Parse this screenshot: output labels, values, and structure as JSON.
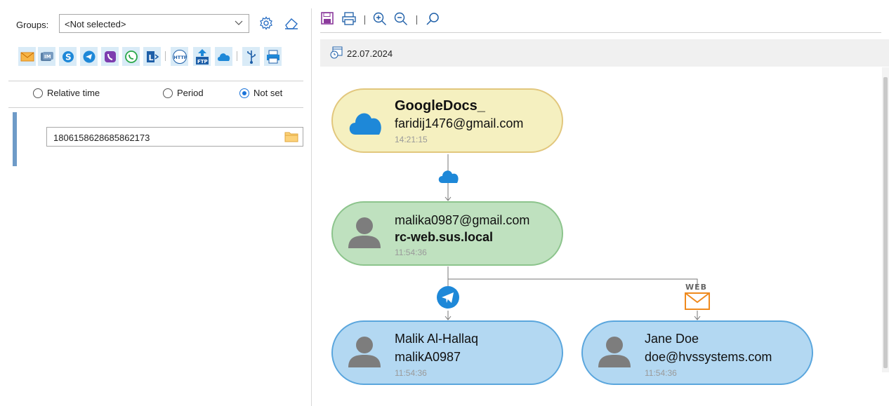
{
  "left": {
    "groups_label": "Groups:",
    "groups_value": "<Not selected>",
    "radios": [
      {
        "label": "Relative time",
        "selected": false
      },
      {
        "label": "Period",
        "selected": false
      },
      {
        "label": "Not set",
        "selected": true
      }
    ],
    "id_value": "1806158628685862173",
    "toolbar_icons": [
      "email-icon",
      "im-icon",
      "skype-icon",
      "telegram-icon",
      "viber-icon",
      "whatsapp-icon",
      "lync-icon",
      "http-icon",
      "ftp-icon",
      "cloud-icon",
      "usb-icon",
      "printer-icon"
    ]
  },
  "right": {
    "toolbar_icons": [
      "save-icon",
      "print-icon",
      "zoom-in-icon",
      "zoom-out-icon",
      "search-icon"
    ],
    "date": "22.07.2024",
    "channel_labels": {
      "web": "WEB"
    },
    "nodes": [
      {
        "title": "GoogleDocs_",
        "subtitle": "faridij1476@gmail.com",
        "time": "14:21:15",
        "icon": "cloud-icon",
        "color": "#f5f0c0"
      },
      {
        "title": "malika0987@gmail.com",
        "subtitle": "rc-web.sus.local",
        "time": "11:54:36",
        "icon": "user-icon",
        "color": "#bfe1bf"
      },
      {
        "title": "Malik Al-Hallaq",
        "subtitle": "malikA0987",
        "time": "11:54:36",
        "icon": "user-icon",
        "color": "#b3d8f2"
      },
      {
        "title": "Jane Doe",
        "subtitle": "doe@hvssystems.com",
        "time": "11:54:36",
        "icon": "user-icon",
        "color": "#b3d8f2"
      }
    ]
  }
}
